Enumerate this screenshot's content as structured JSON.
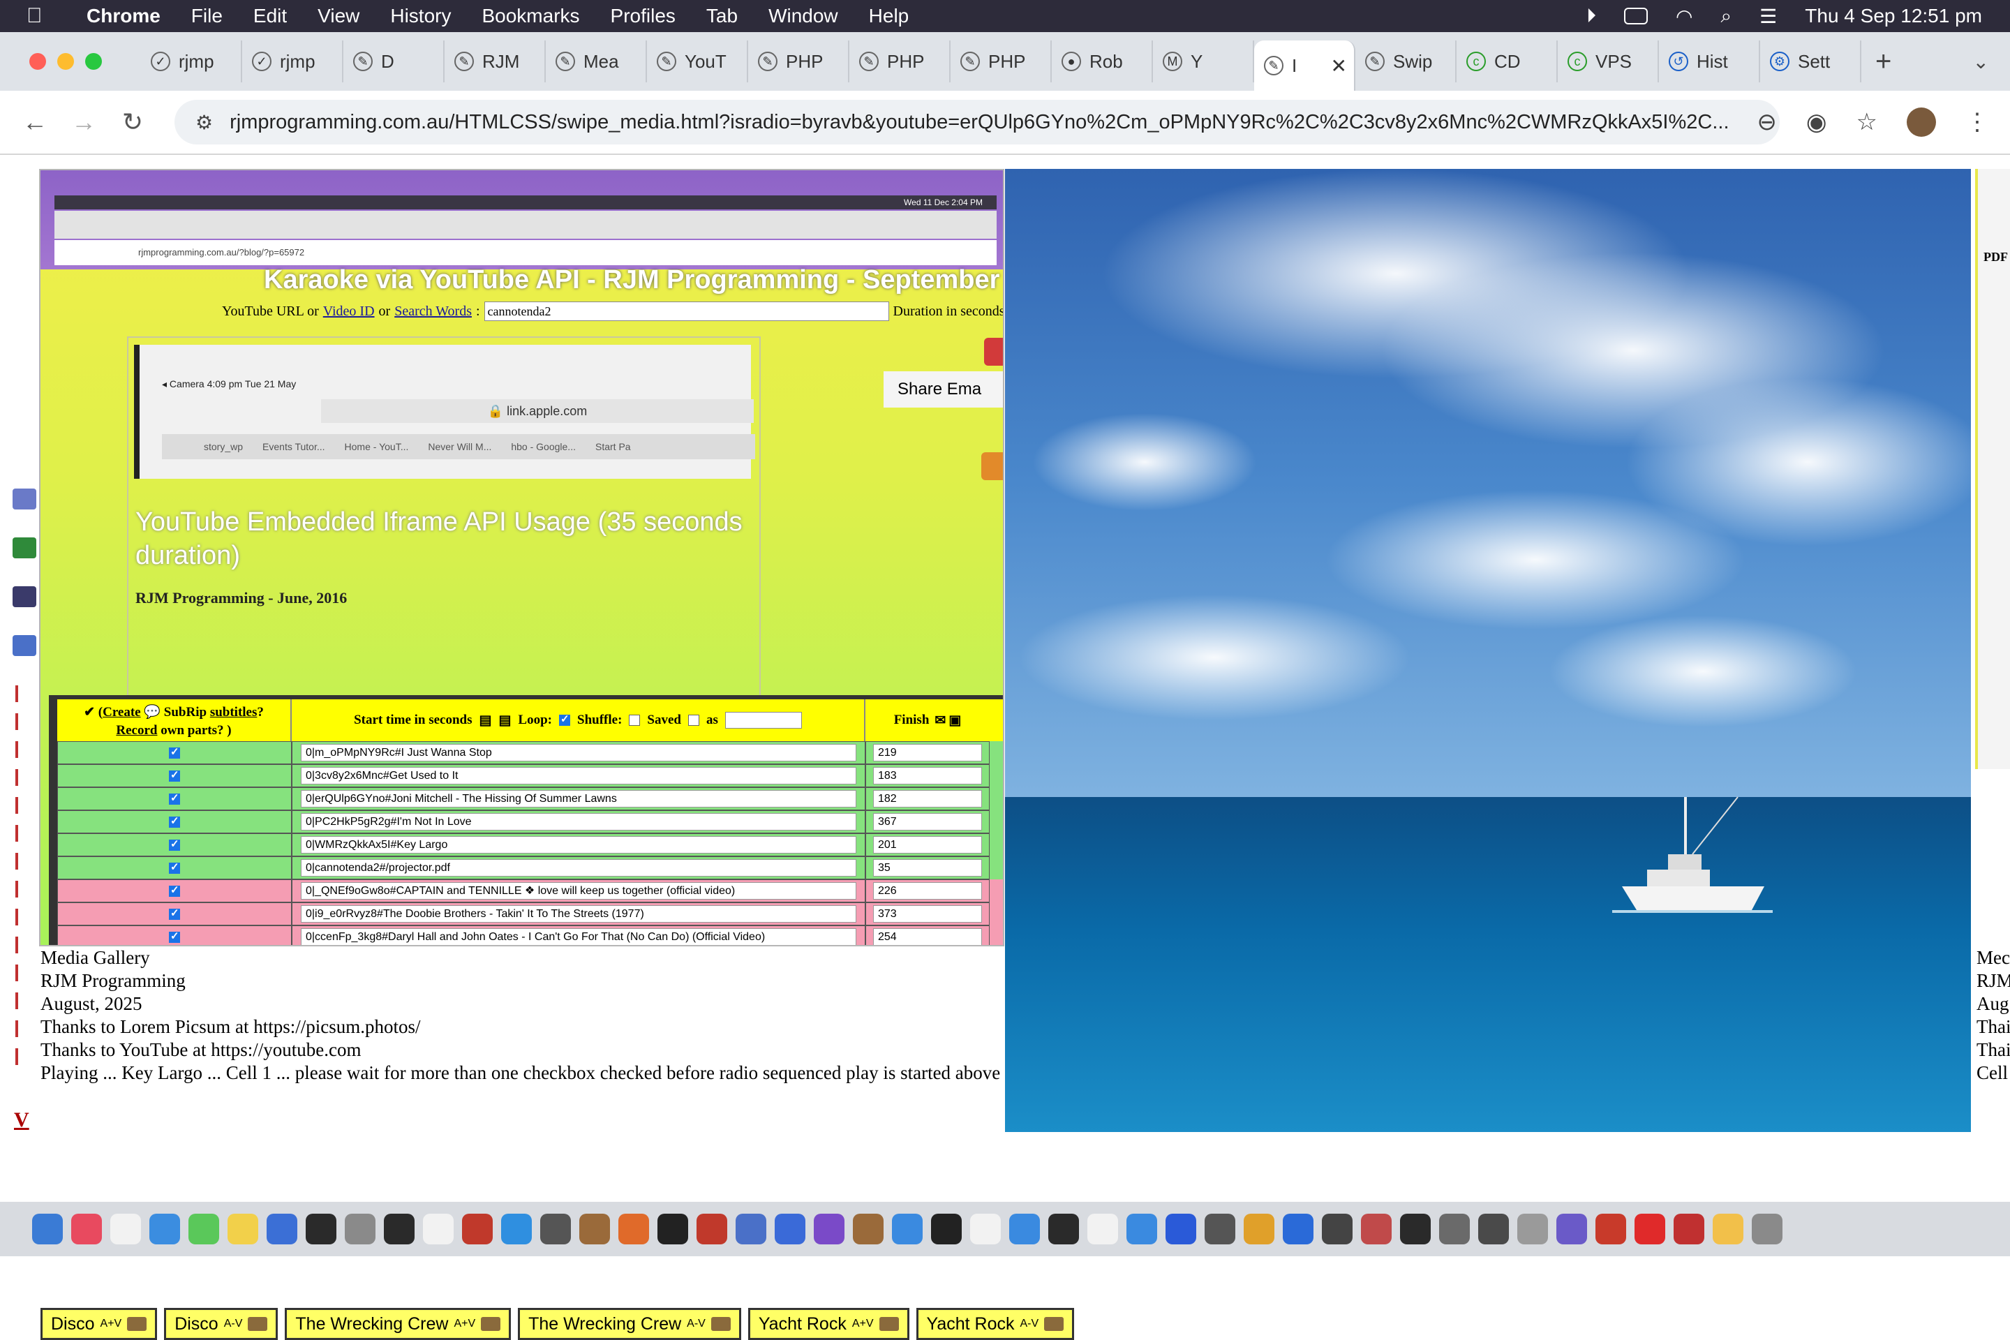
{
  "menubar": {
    "app": "Chrome",
    "items": [
      "File",
      "Edit",
      "View",
      "History",
      "Bookmarks",
      "Profiles",
      "Tab",
      "Window",
      "Help"
    ],
    "clock": "Thu 4 Sep  12:51 pm"
  },
  "tabs": [
    {
      "label": "rjmp"
    },
    {
      "label": "rjmp"
    },
    {
      "label": "D"
    },
    {
      "label": "RJM"
    },
    {
      "label": "Mea"
    },
    {
      "label": "YouT"
    },
    {
      "label": "PHP"
    },
    {
      "label": "PHP"
    },
    {
      "label": "PHP"
    },
    {
      "label": "Rob"
    },
    {
      "label": "Y"
    },
    {
      "label": "I"
    },
    {
      "label": "Swip"
    },
    {
      "label": "CD"
    },
    {
      "label": "VPS"
    },
    {
      "label": "Hist"
    },
    {
      "label": "Sett"
    }
  ],
  "address": {
    "url": "rjmprogramming.com.au/HTMLCSS/swipe_media.html?isradio=byravb&youtube=erQUlp6GYno%2Cm_oPMpNY9Rc%2C%2C3cv8y2x6Mnc%2CWMRzQkkAx5I%2C..."
  },
  "left_panel": {
    "mini_url": "rjmprogramming.com.au/?blog/?p=65972",
    "mini_clock": "Wed 11 Dec  2:04 PM",
    "karaoke_title": "Karaoke via YouTube API - RJM Programming - September",
    "yt_label_prefix": "YouTube URL or",
    "yt_link_video": "Video ID",
    "yt_or": "or",
    "yt_link_search": "Search Words",
    "yt_colon": ":",
    "yt_value": "cannotenda2",
    "duration_label": "Duration in seconds:",
    "share_label": "Share Ema",
    "ipad_status": "◂ Camera   4:09 pm   Tue 21 May",
    "ipad_url": "🔒 link.apple.com",
    "ipad_tabs": [
      "story_wp",
      "Events Tutor...",
      "Home - YouT...",
      "Never Will M...",
      "hbo - Google...",
      "Start Pa"
    ],
    "embed_title": "YouTube Embedded Iframe API Usage (35 seconds duration)",
    "byline": "RJM Programming - June, 2016"
  },
  "playlist": {
    "head_col1_pre": "✔ (",
    "head_col1_create": "Create",
    "head_col1_mid": " 💬 SubRip ",
    "head_col1_subtitles": "subtitles",
    "head_col1_q": "?",
    "head_col1_record": "Record",
    "head_col1_post": " own parts?      )",
    "head_col2_start": "Start time in seconds",
    "head_col2_loop": "Loop:",
    "head_col2_shuffle": "Shuffle:",
    "head_col2_saved": "Saved",
    "head_col2_as": "as",
    "head_col3": "Finish",
    "rows": [
      {
        "entry": "0|m_oPMpNY9Rc#I Just Wanna Stop",
        "finish": "219",
        "color": "green"
      },
      {
        "entry": "0|3cv8y2x6Mnc#Get Used to It",
        "finish": "183",
        "color": "green"
      },
      {
        "entry": "0|erQUlp6GYno#Joni Mitchell - The Hissing Of Summer Lawns",
        "finish": "182",
        "color": "green"
      },
      {
        "entry": "0|PC2HkP5gR2g#I'm Not In Love",
        "finish": "367",
        "color": "green"
      },
      {
        "entry": "0|WMRzQkkAx5I#Key Largo",
        "finish": "201",
        "color": "green"
      },
      {
        "entry": "0|cannotenda2#/projector.pdf",
        "finish": "35",
        "color": "green"
      },
      {
        "entry": "0|_QNEf9oGw8o#CAPTAIN and TENNILLE ❖ love will keep us together (official video)",
        "finish": "226",
        "color": "pink"
      },
      {
        "entry": "0|i9_e0rRvyz8#The Doobie Brothers - Takin' It To The Streets (1977)",
        "finish": "373",
        "color": "pink"
      },
      {
        "entry": "0|ccenFp_3kg8#Daryl Hall and John Oates - I Can't Go For That (No Can Do) (Official Video)",
        "finish": "254",
        "color": "pink"
      }
    ]
  },
  "caption": {
    "lines": [
      "Media Gallery",
      "RJM Programming",
      "August, 2025",
      "Thanks to Lorem Picsum at https://picsum.photos/",
      "Thanks to YouTube at https://youtube.com",
      "Playing ... Key Largo ... Cell 1 ... please wait for more than one checkbox checked before radio sequenced play is started above"
    ]
  },
  "right_edge": {
    "pdf_label": "PDF",
    "caption_lines": [
      "Mec",
      "RJM",
      "Aug",
      "Thai",
      "Thai",
      "Cell"
    ]
  },
  "bottom_buttons": [
    {
      "label": "Disco",
      "sup": "A+V",
      "sub": ""
    },
    {
      "label": "Disco",
      "sup": "",
      "sub": "A-V"
    },
    {
      "label": "The Wrecking Crew",
      "sup": "A+V",
      "sub": ""
    },
    {
      "label": "The Wrecking Crew",
      "sup": "",
      "sub": "A-V"
    },
    {
      "label": "Yacht Rock",
      "sup": "A+V",
      "sub": ""
    },
    {
      "label": "Yacht Rock",
      "sup": "",
      "sub": "A-V"
    }
  ],
  "colors": {
    "accent": "#1a73e8",
    "row_green": "#86e27e",
    "row_pink": "#f59db3",
    "button_yellow": "#ffff66"
  }
}
